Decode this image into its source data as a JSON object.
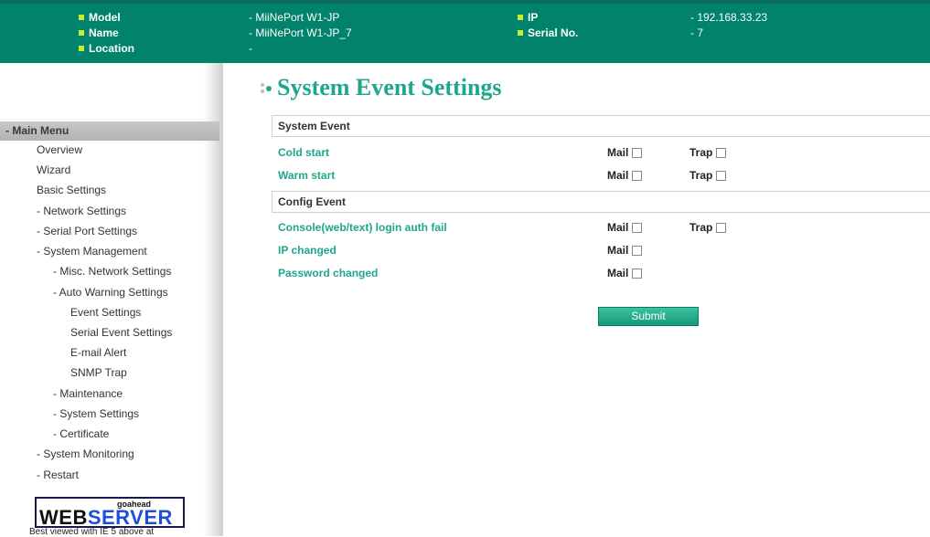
{
  "header": {
    "model_label": "Model",
    "model_value": "- MiiNePort W1-JP",
    "name_label": "Name",
    "name_value": "- MiiNePort W1-JP_7",
    "location_label": "Location",
    "location_value": "-",
    "ip_label": "IP",
    "ip_value": "- 192.168.33.23",
    "serial_label": "Serial No.",
    "serial_value": "- 7"
  },
  "sidebar": {
    "main_menu": "- Main Menu",
    "items": [
      {
        "label": "Overview"
      },
      {
        "label": "Wizard"
      },
      {
        "label": "Basic Settings"
      },
      {
        "label": "- Network Settings"
      },
      {
        "label": "- Serial Port Settings"
      },
      {
        "label": "- System Management"
      },
      {
        "label": "- Misc. Network Settings"
      },
      {
        "label": "- Auto Warning Settings"
      },
      {
        "label": "Event Settings"
      },
      {
        "label": "Serial Event Settings"
      },
      {
        "label": "E-mail Alert"
      },
      {
        "label": "SNMP Trap"
      },
      {
        "label": "- Maintenance"
      },
      {
        "label": "- System Settings"
      },
      {
        "label": "- Certificate"
      },
      {
        "label": "- System Monitoring"
      },
      {
        "label": "- Restart"
      }
    ],
    "logo_small": "goahead",
    "logo_web": "WEB",
    "logo_server": "SERVER",
    "best_viewed": "Best viewed with IE 5 above at"
  },
  "main": {
    "title": "System Event Settings",
    "system_event_header": "System Event",
    "config_event_header": "Config Event",
    "mail_label": "Mail",
    "trap_label": "Trap",
    "rows": [
      {
        "label": "Cold start",
        "mail_checked": false,
        "trap_checked": false
      },
      {
        "label": "Warm start",
        "mail_checked": false,
        "trap_checked": false
      },
      {
        "label": "Console(web/text) login auth fail",
        "mail_checked": false,
        "trap_checked": false
      },
      {
        "label": "IP changed",
        "mail_checked": false
      },
      {
        "label": "Password changed",
        "mail_checked": false
      }
    ],
    "submit_label": "Submit"
  },
  "colors": {
    "header_bg": "#00826b",
    "accent_green": "#1fa68b",
    "bullet": "#c8e83a",
    "logo_blue": "#1f4fd6"
  }
}
